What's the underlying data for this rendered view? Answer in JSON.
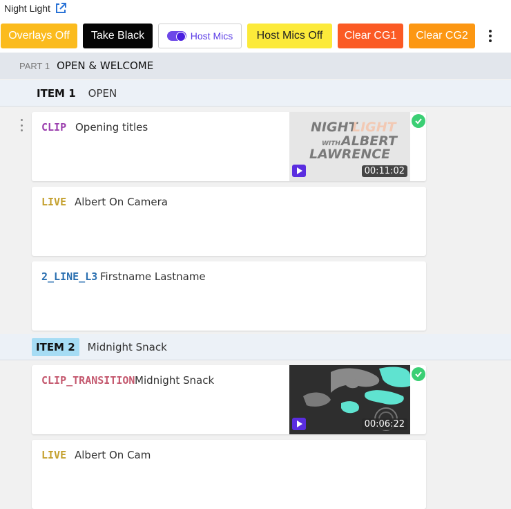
{
  "app": {
    "title": "Night Light"
  },
  "toolbar": {
    "overlays_off": "Overlays Off",
    "take_black": "Take Black",
    "host_mics": "Host Mics",
    "host_mics_off": "Host Mics Off",
    "clear_cg1": "Clear CG1",
    "clear_cg2": "Clear CG2"
  },
  "part": {
    "label": "PART 1",
    "title": "OPEN & WELCOME"
  },
  "items": [
    {
      "label": "ITEM 1",
      "name": "OPEN"
    },
    {
      "label": "ITEM 2",
      "name": "Midnight Snack"
    }
  ],
  "cards": [
    {
      "type": "CLIP",
      "type_color": "#9b3fae",
      "desc": "Opening titles",
      "duration": "00:11:02",
      "thumb_text": [
        "NIGHT",
        "LIGHT",
        "WITH",
        "ALBERT",
        "LAWRENCE"
      ]
    },
    {
      "type": "LIVE",
      "type_color": "#c4a02d",
      "desc": "Albert On Camera"
    },
    {
      "type": "2_LINE_L3",
      "type_color": "#2a6fb0",
      "desc": "Firstname Lastname"
    },
    {
      "type": "CLIP_TRANSITION",
      "type_color": "#c4586e",
      "desc": "Midnight Snack",
      "duration": "00:06:22"
    },
    {
      "type": "LIVE",
      "type_color": "#c4a02d",
      "desc": "Albert On Cam"
    }
  ],
  "colors": {
    "accent": "#5a2de0",
    "status_ok": "#3bcf74"
  },
  "icons": {
    "external_link": "external-link-icon",
    "more": "more-vertical-icon",
    "play": "play-icon",
    "check": "check-circle-icon",
    "drag": "drag-handle-icon"
  }
}
